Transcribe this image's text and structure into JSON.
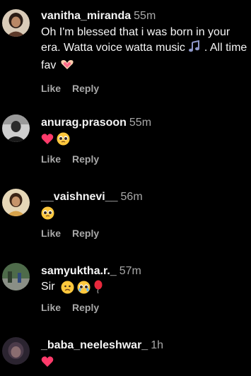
{
  "comments": [
    {
      "username": "vanitha_miranda",
      "time": "55m",
      "text": "Oh I'm blessed that i was born in your era. Watta voice watta music",
      "text_tail": ". All time fav",
      "like": "Like",
      "reply": "Reply",
      "emojis": [
        "music-notes",
        "heart-hands"
      ]
    },
    {
      "username": "anurag.prasoon",
      "time": "55m",
      "like": "Like",
      "reply": "Reply",
      "emojis": [
        "pink-heart",
        "pleading-face"
      ]
    },
    {
      "username": "__vaishnevi__",
      "time": "56m",
      "like": "Like",
      "reply": "Reply",
      "emojis": [
        "pleading-face"
      ]
    },
    {
      "username": "samyuktha.r._",
      "time": "57m",
      "text": "Sir",
      "like": "Like",
      "reply": "Reply",
      "emojis": [
        "frowning-face",
        "crying-face",
        "balloon"
      ]
    },
    {
      "username": "_baba_neeleshwar_",
      "time": "1h",
      "emojis": [
        "pink-heart"
      ]
    }
  ],
  "colors": {
    "background": "#000000",
    "primary_text": "#f5f5f5",
    "secondary_text": "#a8a8a8",
    "heart": "#ff3b6b"
  }
}
